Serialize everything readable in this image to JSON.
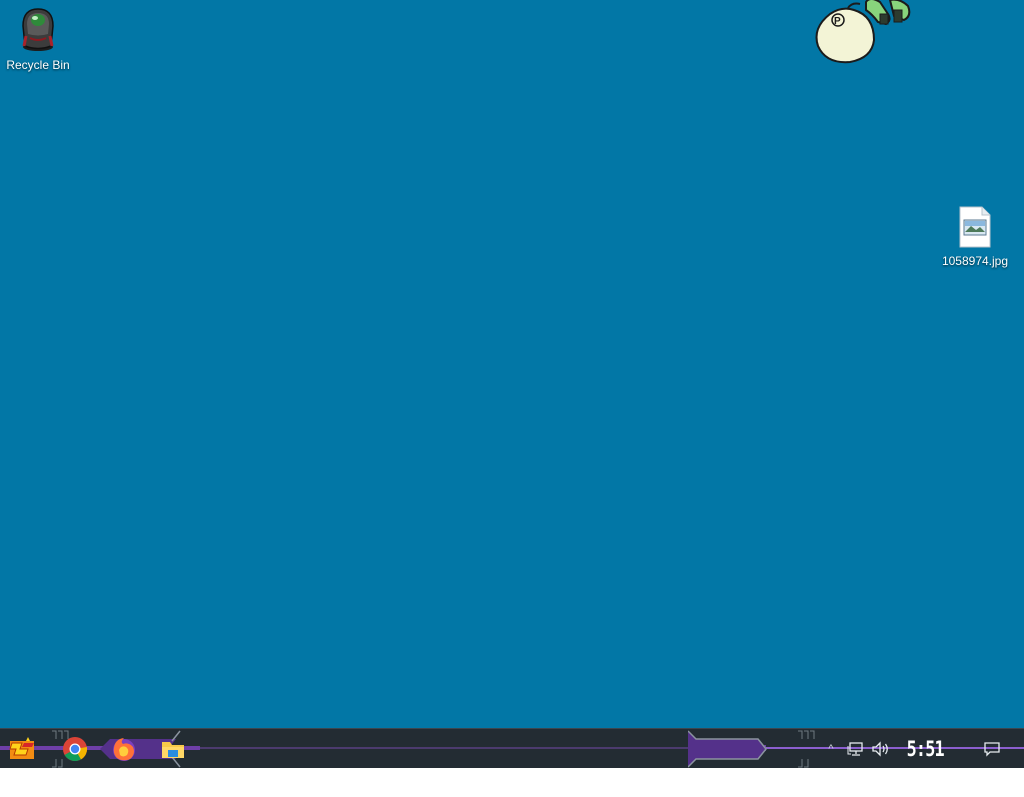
{
  "desktop": {
    "background_color": "#0277a6",
    "icons": [
      {
        "label": "Recycle Bin",
        "icon": "recycle-bin-icon"
      },
      {
        "label": "1058974.jpg",
        "icon": "image-file-icon"
      }
    ],
    "mascot_badge_letter": "P"
  },
  "taskbar": {
    "background_color": "#232c33",
    "accent_color": "#6e3fa8",
    "pinned": [
      {
        "name": "start",
        "icon": "start-icon"
      },
      {
        "name": "chrome",
        "icon": "chrome-icon"
      },
      {
        "name": "firefox",
        "icon": "firefox-icon"
      },
      {
        "name": "file-explorer",
        "icon": "folder-icon"
      }
    ],
    "tray": {
      "chevron": "^",
      "icons": [
        "network-icon",
        "volume-icon",
        "notification-icon"
      ],
      "clock": "5:51 AM"
    }
  }
}
